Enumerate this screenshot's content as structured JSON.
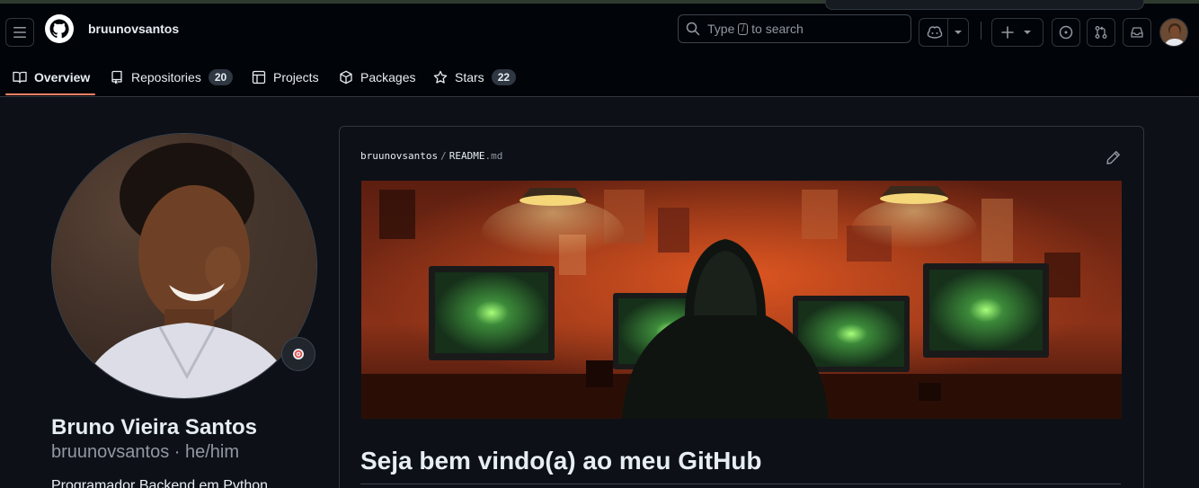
{
  "header": {
    "username": "bruunovsantos",
    "search_prefix": "Type",
    "search_key": "/",
    "search_suffix": "to search"
  },
  "tabs": [
    {
      "label": "Overview",
      "count": null
    },
    {
      "label": "Repositories",
      "count": "20"
    },
    {
      "label": "Projects",
      "count": null
    },
    {
      "label": "Packages",
      "count": null
    },
    {
      "label": "Stars",
      "count": "22"
    }
  ],
  "profile": {
    "full_name": "Bruno Vieira Santos",
    "handle": "bruunovsantos · he/him",
    "bio": "Programador Backend em Python"
  },
  "readme": {
    "owner": "bruunovsantos",
    "separator": "/",
    "file": "README",
    "ext": ".md",
    "heading": "Seja bem vindo(a) ao meu GitHub"
  },
  "colors": {
    "background": "#0d1117",
    "header": "#010409",
    "accent_underline": "#f78166"
  }
}
